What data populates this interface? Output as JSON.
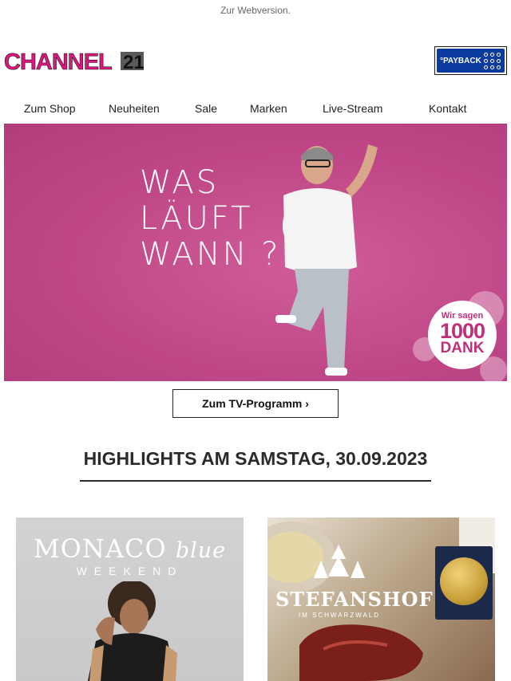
{
  "header": {
    "webversion_link": "Zur Webversion.",
    "logo_text": "CHANNEL",
    "logo_number": "21",
    "payback_label": "°PAYBACK"
  },
  "nav": {
    "items": [
      "Zum Shop",
      "Neuheiten",
      "Sale",
      "Marken",
      "Live-Stream",
      "Kontakt"
    ]
  },
  "hero": {
    "headline_line1": "WAS",
    "headline_line2": "LÄUFT",
    "headline_line3": "WANN ?",
    "badge_line1": "Wir sagen",
    "badge_line2": "1000",
    "badge_line3": "DANK"
  },
  "cta": {
    "label": "Zum TV-Programm ›"
  },
  "highlights": {
    "heading": "HIGHLIGHTS AM SAMSTAG, 30.09.2023",
    "cards": [
      {
        "brand": "MONACO",
        "brand_script": "blue",
        "sub": "WEEKEND"
      },
      {
        "brand": "STEFANSHOF",
        "sub": "IM SCHWARZWALD"
      }
    ]
  },
  "colors": {
    "brand_magenta": "#e0157f",
    "hero_pink": "#c24c8c",
    "payback_blue": "#0b3aa0"
  }
}
